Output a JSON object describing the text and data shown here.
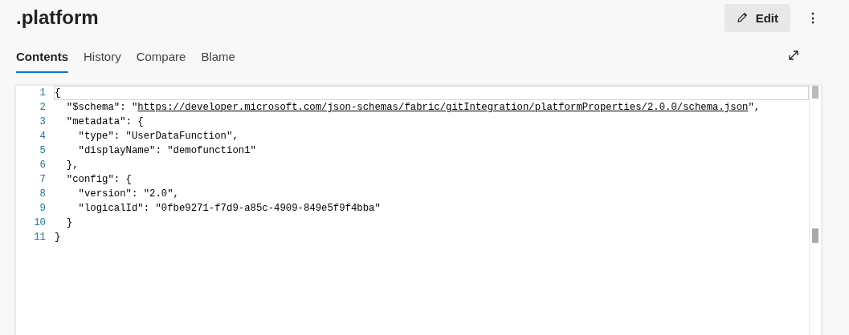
{
  "title": ".platform",
  "actions": {
    "edit": "Edit",
    "more": "⋮"
  },
  "tabs": [
    {
      "label": "Contents",
      "selected": true
    },
    {
      "label": "History",
      "selected": false
    },
    {
      "label": "Compare",
      "selected": false
    },
    {
      "label": "Blame",
      "selected": false
    }
  ],
  "editor": {
    "lines": [
      {
        "number": "1",
        "current": true,
        "segments": [
          {
            "kind": "text",
            "text": "{"
          }
        ]
      },
      {
        "number": "2",
        "current": false,
        "segments": [
          {
            "kind": "text",
            "text": "  \"$schema\": \""
          },
          {
            "kind": "link",
            "text": "https://developer.microsoft.com/json-schemas/fabric/gitIntegration/platformProperties/2.0.0/schema.json"
          },
          {
            "kind": "text",
            "text": "\","
          }
        ]
      },
      {
        "number": "3",
        "current": false,
        "segments": [
          {
            "kind": "text",
            "text": "  \"metadata\": {"
          }
        ]
      },
      {
        "number": "4",
        "current": false,
        "segments": [
          {
            "kind": "text",
            "text": "    \"type\": \"UserDataFunction\","
          }
        ]
      },
      {
        "number": "5",
        "current": false,
        "segments": [
          {
            "kind": "text",
            "text": "    \"displayName\": \"demofunction1\""
          }
        ]
      },
      {
        "number": "6",
        "current": false,
        "segments": [
          {
            "kind": "text",
            "text": "  },"
          }
        ]
      },
      {
        "number": "7",
        "current": false,
        "segments": [
          {
            "kind": "text",
            "text": "  \"config\": {"
          }
        ]
      },
      {
        "number": "8",
        "current": false,
        "segments": [
          {
            "kind": "text",
            "text": "    \"version\": \"2.0\","
          }
        ]
      },
      {
        "number": "9",
        "current": false,
        "segments": [
          {
            "kind": "text",
            "text": "    \"logicalId\": \"0fbe9271-f7d9-a85c-4909-849e5f9f4bba\""
          }
        ]
      },
      {
        "number": "10",
        "current": false,
        "segments": [
          {
            "kind": "text",
            "text": "  }"
          }
        ]
      },
      {
        "number": "11",
        "current": false,
        "segments": [
          {
            "kind": "text",
            "text": "}"
          }
        ]
      }
    ]
  }
}
